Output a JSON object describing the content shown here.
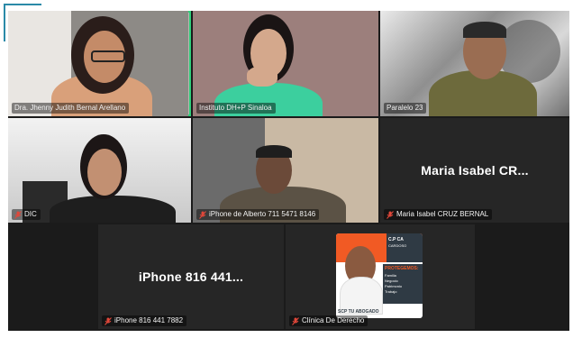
{
  "participants": [
    {
      "id": "p1",
      "name": "Dra. Jhenny Judith Bernal Arellano",
      "muted": false,
      "active": true
    },
    {
      "id": "p2",
      "name": "Instituto DH+P Sinaloa",
      "muted": false,
      "active": false
    },
    {
      "id": "p3",
      "name": "Paralelo 23",
      "muted": false,
      "active": false
    },
    {
      "id": "p4",
      "name": "DIC",
      "muted": true,
      "active": false
    },
    {
      "id": "p5",
      "name": "iPhone de Alberto 711 5471 8146",
      "muted": true,
      "active": false
    },
    {
      "id": "p6",
      "name": "Maria Isabel CRUZ BERNAL",
      "display": "Maria Isabel CR...",
      "muted": true,
      "active": false
    },
    {
      "id": "p7",
      "name": "iPhone 816 441 7882",
      "display": "iPhone 816 441...",
      "muted": true,
      "active": false
    },
    {
      "id": "p8",
      "name": "Clínica De Derecho",
      "muted": true,
      "active": false
    }
  ],
  "poster": {
    "header_line1": "C.P CA",
    "header_line2": "CARDOSO",
    "title": "PROTEGEMOS:",
    "items": [
      "Familia",
      "Negocio",
      "Patrimonio",
      "Trabajo"
    ],
    "footer": "SCP TU ABOGADO"
  },
  "colors": {
    "active_border": "#2fd07a",
    "muted_icon": "#e0473a",
    "tile_bg": "#2b2b2b"
  }
}
